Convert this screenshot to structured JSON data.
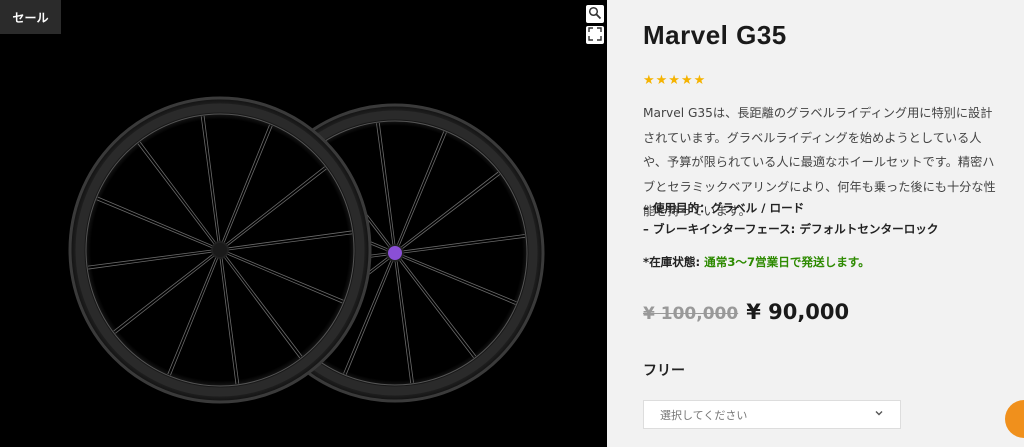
{
  "gallery": {
    "sale_badge": "セール",
    "zoom_icon": "magnifier-icon",
    "fullscreen_icon": "expand-icon",
    "image": "wheelset-photo"
  },
  "product": {
    "title": "Marvel G35",
    "rating": {
      "stars": 5,
      "max": 5,
      "glyphs": "★★★★★",
      "color": "#f5b301"
    },
    "description": "Marvel G35は、長距離のグラベルライディング用に特別に設計されています。グラベルライディングを始めようとしている人や、予算が限られている人に最適なホイールセットです。精密ハブとセラミックベアリングにより、何年も乗った後にも十分な性能を持っています。",
    "specs": [
      "– 使用目的：グラベル / ロード",
      "– ブレーキインターフェース: デフォルトセンターロック"
    ],
    "stock_label": "*在庫状態: ",
    "stock_value": "通常3〜7営業日で発送します。",
    "old_price": "¥ 100,000",
    "new_price": "¥ 90,000",
    "variation_label": "フリー",
    "select_placeholder": "選択してください",
    "select_icon": "chevron-down-icon"
  },
  "colors": {
    "stock_green": "#2d8a00",
    "chat_orange": "#f0901c",
    "hub_purple": "#8a4fd6"
  }
}
